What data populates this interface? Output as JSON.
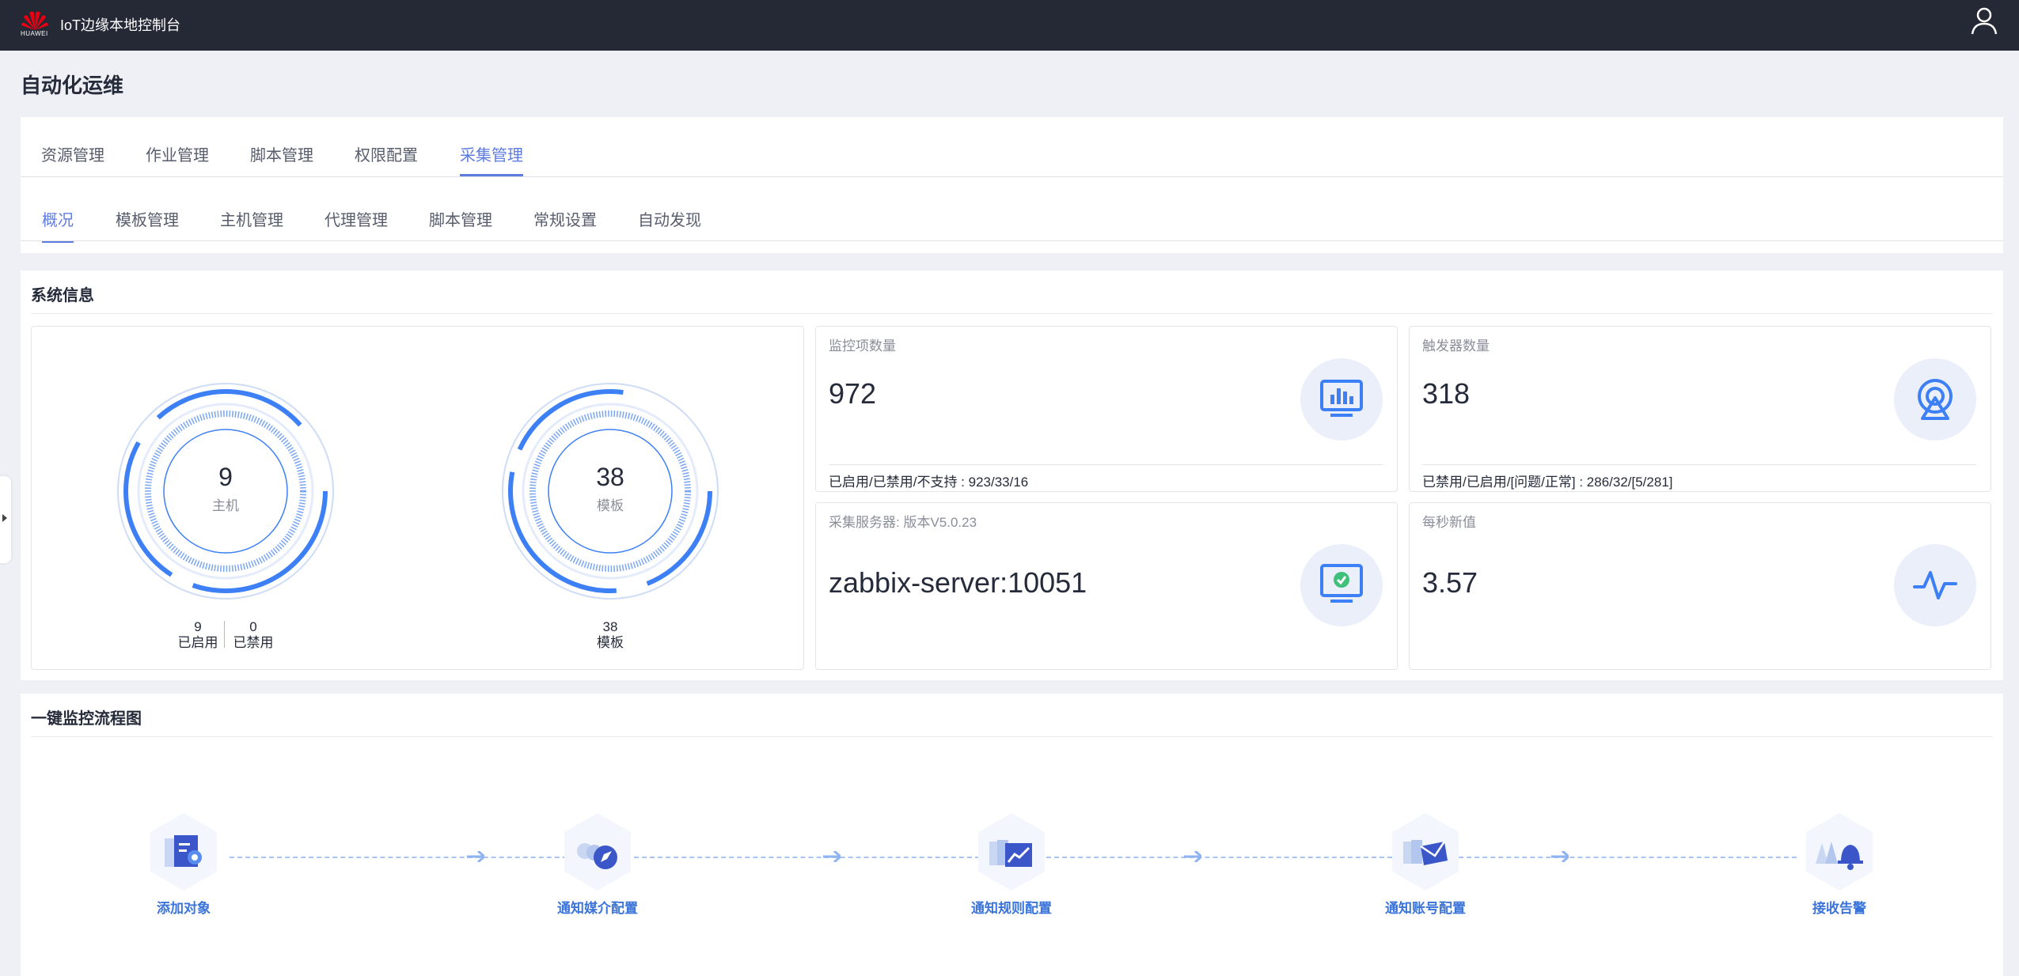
{
  "header": {
    "logo_text": "HUAWEI",
    "app_title": "IoT边缘本地控制台",
    "icons": {
      "logo": "huawei-logo-icon",
      "user": "user-icon"
    }
  },
  "page_title": "自动化运维",
  "main_tabs": [
    {
      "label": "资源管理",
      "active": false
    },
    {
      "label": "作业管理",
      "active": false
    },
    {
      "label": "脚本管理",
      "active": false
    },
    {
      "label": "权限配置",
      "active": false
    },
    {
      "label": "采集管理",
      "active": true
    }
  ],
  "sub_tabs": [
    {
      "label": "概况",
      "active": true
    },
    {
      "label": "模板管理",
      "active": false
    },
    {
      "label": "主机管理",
      "active": false
    },
    {
      "label": "代理管理",
      "active": false
    },
    {
      "label": "脚本管理",
      "active": false
    },
    {
      "label": "常规设置",
      "active": false
    },
    {
      "label": "自动发现",
      "active": false
    }
  ],
  "system_info": {
    "title": "系统信息",
    "hosts_ring": {
      "value": "9",
      "label": "主机",
      "enabled_count": "9",
      "enabled_label": "已启用",
      "disabled_count": "0",
      "disabled_label": "已禁用"
    },
    "templates_ring": {
      "value": "38",
      "label": "模板",
      "foot_count": "38",
      "foot_label": "模板"
    },
    "monitor_items": {
      "label": "监控项数量",
      "value": "972",
      "foot": "已启用/已禁用/不支持 : 923/33/16",
      "icon": "chart-monitor-icon"
    },
    "triggers": {
      "label": "触发器数量",
      "value": "318",
      "foot": "已禁用/已启用/[问题/正常] : 286/32/[5/281]",
      "icon": "broadcast-icon"
    },
    "server": {
      "label": "采集服务器:  版本V5.0.23",
      "value": "zabbix-server:10051",
      "icon": "monitor-check-icon"
    },
    "nvps": {
      "label": "每秒新值",
      "value": "3.57",
      "icon": "pulse-icon"
    },
    "colors": {
      "accent": "#5e7ce0",
      "ring": "#3d7ff5",
      "icon_bg": "#ebeffa"
    }
  },
  "flow": {
    "title": "一键监控流程图",
    "steps": [
      {
        "label": "添加对象",
        "icon": "add-object-icon"
      },
      {
        "label": "通知媒介配置",
        "icon": "compass-media-icon"
      },
      {
        "label": "通知规则配置",
        "icon": "trend-rule-icon"
      },
      {
        "label": "通知账号配置",
        "icon": "mail-account-icon"
      },
      {
        "label": "接收告警",
        "icon": "bell-alarm-icon"
      }
    ]
  }
}
